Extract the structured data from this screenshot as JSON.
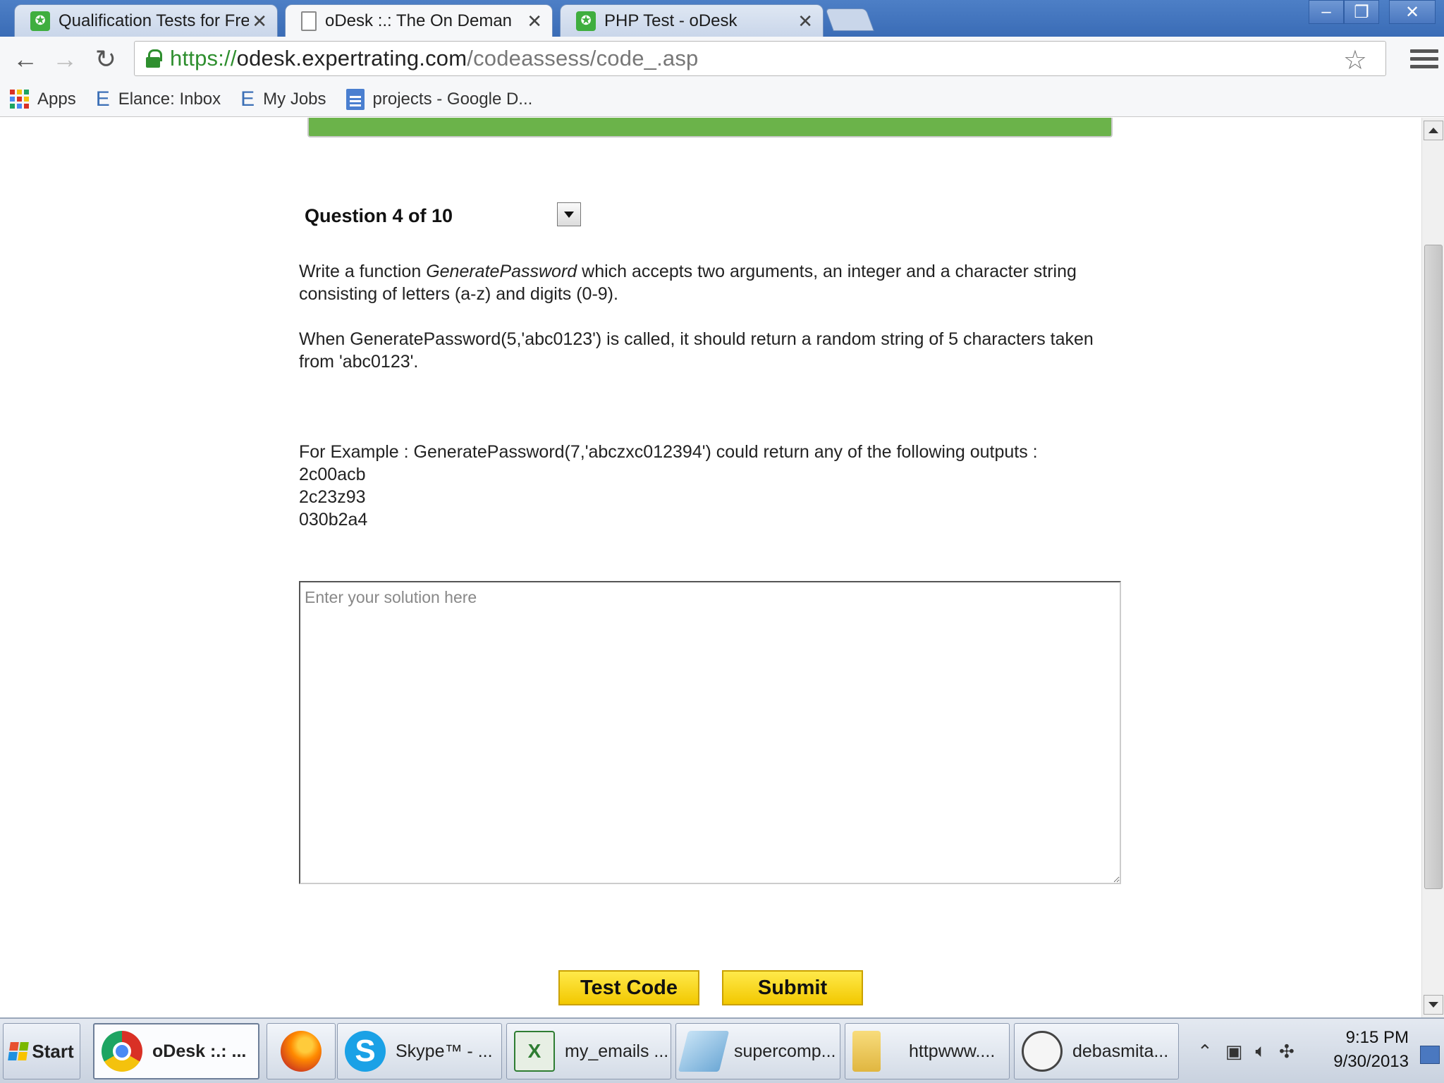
{
  "browser": {
    "tabs": [
      {
        "title": "Qualification Tests for Fre",
        "favicon": "odesk-icon",
        "active": false
      },
      {
        "title": "oDesk :.: The On Deman",
        "favicon": "page-icon",
        "active": true
      },
      {
        "title": "PHP Test - oDesk",
        "favicon": "odesk-icon",
        "active": false
      }
    ],
    "url_scheme": "https://",
    "url_host": "odesk.expertrating.com",
    "url_path": "/codeassess/code_.asp",
    "bookmarks": [
      {
        "label": "Apps"
      },
      {
        "label": "Elance: Inbox"
      },
      {
        "label": "My Jobs"
      },
      {
        "label": "projects - Google D..."
      }
    ]
  },
  "question": {
    "title": "Question 4 of 10",
    "p1_a": "Write a function ",
    "p1_fn": "GeneratePassword",
    "p1_b": " which accepts two arguments, an integer and a character string consisting of letters (a-z) and digits (0-9).",
    "p2": "When GeneratePassword(5,'abc0123') is called, it should return a random string of 5 characters taken from 'abc0123'.",
    "example_intro": "For Example : GeneratePassword(7,'abczxc012394') could return any of the following outputs :",
    "outputs": [
      "2c00acb",
      "2c23z93",
      "030b2a4"
    ]
  },
  "solution": {
    "placeholder": "Enter your solution here",
    "value": ""
  },
  "actions": {
    "test_label": "Test Code",
    "submit_label": "Submit"
  },
  "taskbar": {
    "start_label": "Start",
    "items": [
      {
        "label": "oDesk :.: ...",
        "icon": "chrome-icon",
        "active": true
      },
      {
        "label": "",
        "icon": "firefox-icon",
        "active": false
      },
      {
        "label": "Skype™ - ...",
        "icon": "skype-icon",
        "active": false
      },
      {
        "label": "my_emails ...",
        "icon": "excel-icon",
        "active": false
      },
      {
        "label": "supercomp...",
        "icon": "notepad-icon",
        "active": false
      },
      {
        "label": "httpwww....",
        "icon": "folder-icon",
        "active": false
      },
      {
        "label": "debasmita...",
        "icon": "chat-icon",
        "active": false
      }
    ],
    "clock_time": "9:15 PM",
    "clock_date": "9/30/2013"
  },
  "colors": {
    "timer_bar": "#6bb34a",
    "button_yellow": "#ffe94a",
    "tab_strip": "#4d7fc6"
  }
}
